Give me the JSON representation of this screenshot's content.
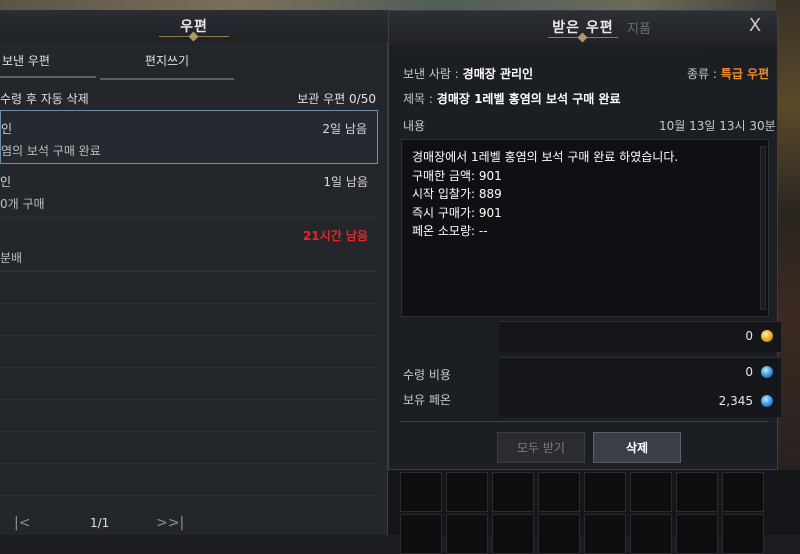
{
  "mailbox": {
    "title": "우편",
    "tabs": [
      {
        "label": "보낸 우편"
      },
      {
        "label": "편지쓰기"
      }
    ],
    "auto_delete_label": "수령 후 자동 삭제",
    "storage_label": "보관 우편 0/50",
    "mails": [
      {
        "sender": "인",
        "subject": "염의 보석 구매 완료",
        "remaining": "2일 남음",
        "urgent": false
      },
      {
        "sender": "인",
        "subject": "0개 구매",
        "remaining": "1일 남음",
        "urgent": false
      },
      {
        "sender": "",
        "subject": "분배",
        "remaining": "21시간 남음",
        "urgent": true
      }
    ],
    "pager": {
      "first": "|<",
      "page": "1/1",
      "last": ">>|"
    }
  },
  "detail": {
    "title": "받은 우편",
    "ghost_title": "지품",
    "close_label": "X",
    "sender_label": "보낸 사람 :",
    "sender_value": "경매장 관리인",
    "type_label": "종류 :",
    "type_value": "특급 우편",
    "subject_label": "제목 :",
    "subject_value": "경매장 1레벨 홍염의 보석 구매 완료",
    "content_label": "내용",
    "date": "10월 13일 13시 30분",
    "body": "경매장에서 1레벨 홍염의 보석 구매 완료 하였습니다.\n구매한 금액: 901\n시작 입찰가: 889\n즉시 구매가: 901\n페온 소모량: --",
    "attached_gold": "0",
    "fee_label": "수령 비용",
    "fee_value": "0",
    "owned_label": "보유 페온",
    "owned_value": "2,345",
    "receive_all_label": "모두 받기",
    "delete_label": "삭제"
  },
  "colors": {
    "accent_orange": "#f08a2a",
    "urgent_red": "#e02828",
    "selected_border": "#6a8fb0"
  }
}
